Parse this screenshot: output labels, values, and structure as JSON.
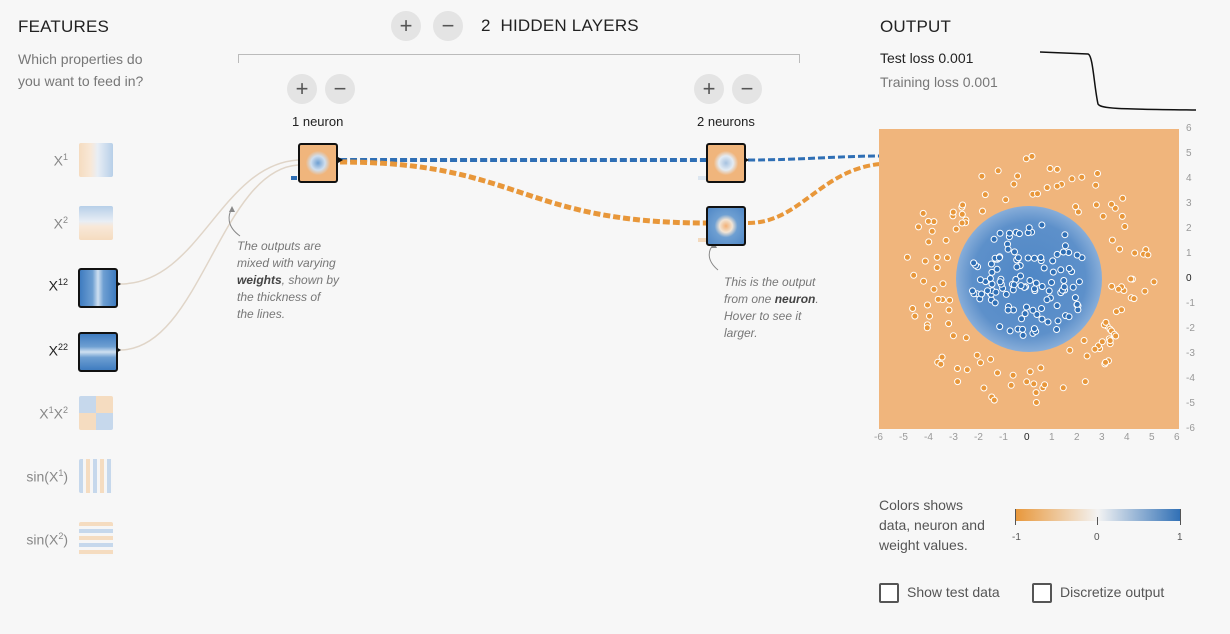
{
  "features": {
    "title": "FEATURES",
    "subtitle_line1": "Which properties do",
    "subtitle_line2": "you want to feed in?",
    "items": [
      {
        "base": "X",
        "sup": "1",
        "tail": "",
        "active": false
      },
      {
        "base": "X",
        "sup": "2",
        "tail": "",
        "active": false
      },
      {
        "base": "X",
        "sup": "12",
        "tail": "",
        "active": true
      },
      {
        "base": "X",
        "sup": "22",
        "tail": "",
        "active": true
      },
      {
        "base": "X",
        "sup": "1",
        "base2": "X",
        "sup2": "2",
        "tail": "",
        "active": false
      },
      {
        "base": "sin(X",
        "sup": "1",
        "tail": ")",
        "active": false
      },
      {
        "base": "sin(X",
        "sup": "2",
        "tail": ")",
        "active": false
      }
    ]
  },
  "network": {
    "add_layer_label": "+",
    "remove_layer_label": "−",
    "hidden_layers_count": "2",
    "hidden_layers_label": "HIDDEN LAYERS",
    "layers": [
      {
        "plus": "+",
        "minus": "−",
        "neurons_label": "1 neuron"
      },
      {
        "plus": "+",
        "minus": "−",
        "neurons_label": "2 neurons"
      }
    ],
    "annotation_weights": {
      "line1": "The outputs are",
      "line2": "mixed with varying",
      "line3_bold": "weights",
      "line3_rest": ", shown by",
      "line4": "the thickness of",
      "line5": "the lines."
    },
    "annotation_neuron": {
      "line1": "This is the output",
      "line2_pre": "from one ",
      "line2_bold": "neuron",
      "line2_post": ".",
      "line3": "Hover to see it",
      "line4": "larger."
    }
  },
  "output": {
    "title": "OUTPUT",
    "test_loss_label": "Test loss",
    "test_loss_value": "0.001",
    "training_loss_label": "Training loss",
    "training_loss_value": "0.001",
    "x_ticks": [
      "-6",
      "-5",
      "-4",
      "-3",
      "-2",
      "-1",
      "0",
      "1",
      "2",
      "3",
      "4",
      "5",
      "6"
    ],
    "y_ticks": [
      "6",
      "5",
      "4",
      "3",
      "2",
      "1",
      "0",
      "-1",
      "-2",
      "-3",
      "-4",
      "-5",
      "-6"
    ],
    "legend_text_line1": "Colors shows",
    "legend_text_line2": "data, neuron and",
    "legend_text_line3": "weight values.",
    "legend_min": "-1",
    "legend_mid": "0",
    "legend_max": "1",
    "show_test_data_label": "Show test data",
    "discretize_output_label": "Discretize output",
    "colors": {
      "orange": "#e8973a",
      "blue": "#2f6fb5",
      "bg_orange": "#f0b57c"
    }
  }
}
